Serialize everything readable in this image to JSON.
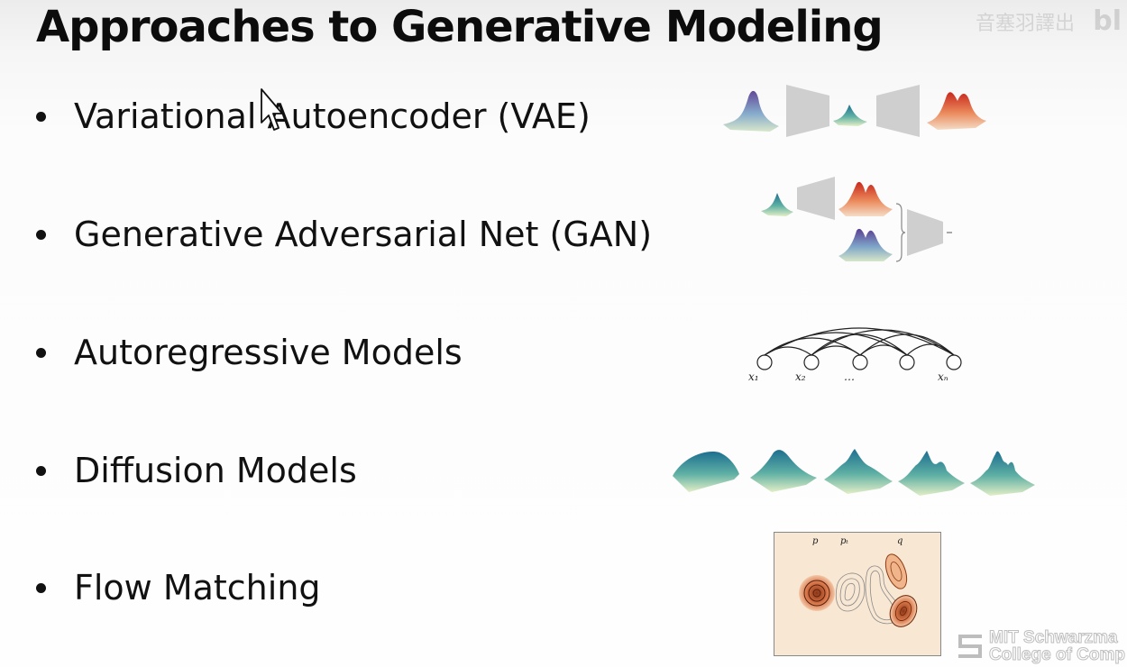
{
  "slide": {
    "title": "Approaches to Generative Modeling",
    "bullets": [
      {
        "label": "Variational Autoencoder (VAE)"
      },
      {
        "label": "Generative Adversarial Net (GAN)"
      },
      {
        "label": "Autoregressive Models"
      },
      {
        "label": "Diffusion Models"
      },
      {
        "label": "Flow Matching"
      }
    ]
  },
  "autoregressive_diagram": {
    "node_labels": [
      "x₁",
      "x₂",
      "…",
      "",
      "xₙ"
    ]
  },
  "flow_matching_plot": {
    "labels": [
      "p",
      "pₜ",
      "q"
    ]
  },
  "watermark": {
    "top_right_text": "音塞羽譯出",
    "top_right_logo": "bl",
    "logo_line1": "MIT Schwarzma",
    "logo_line2": "College of Comp"
  },
  "colors": {
    "background": "#fdfdfd",
    "text": "#111111"
  },
  "icons": {
    "cursor": "mouse-pointer-icon",
    "logo": "mit-schwarzman-logo-icon"
  }
}
